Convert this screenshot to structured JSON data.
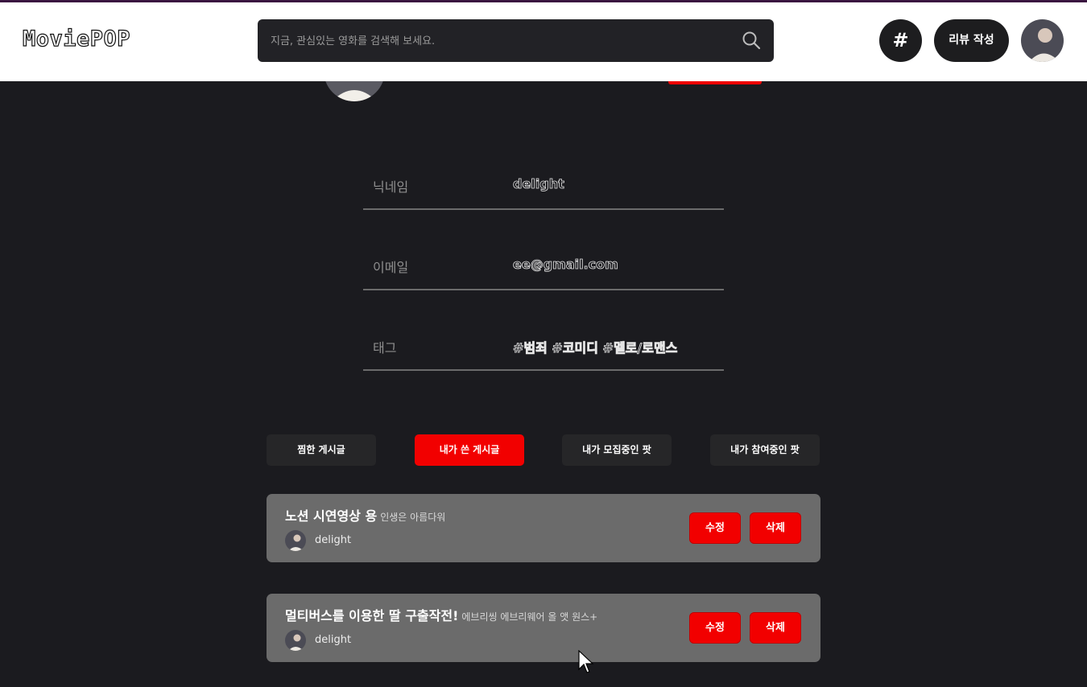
{
  "header": {
    "logo": "MoviePOP",
    "search_placeholder": "지금, 관심있는 영화를 검색해 보세요.",
    "hash_label": "#",
    "write_review_label": "리뷰 작성"
  },
  "profile": {
    "fields": [
      {
        "label": "닉네임",
        "value": "delight"
      },
      {
        "label": "이메일",
        "value": "ee@gmail.com"
      },
      {
        "label": "태그",
        "value": "#범죄 #코미디 #멜로/로맨스"
      }
    ]
  },
  "tabs": [
    {
      "label": "찜한 게시글",
      "active": false
    },
    {
      "label": "내가 쓴 게시글",
      "active": true
    },
    {
      "label": "내가 모집중인 팟",
      "active": false
    },
    {
      "label": "내가 참여중인 팟",
      "active": false
    }
  ],
  "posts": [
    {
      "title": "노션 시연영상 용",
      "subtitle": "인생은 아름다워",
      "author": "delight",
      "edit_label": "수정",
      "delete_label": "삭제"
    },
    {
      "title": "멀티버스를 이용한 딸 구출작전!",
      "subtitle": "에브리씽 에브리웨어 올 앳 원스+",
      "author": "delight",
      "edit_label": "수정",
      "delete_label": "삭제"
    }
  ],
  "colors": {
    "background": "#1b1b1f",
    "accent_red": "#f20000",
    "post_card": "#6b6b6b"
  }
}
